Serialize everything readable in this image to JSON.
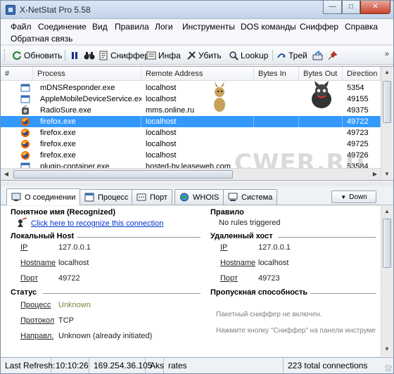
{
  "window": {
    "title": "X-NetStat Pro 5.58"
  },
  "menu": {
    "items": [
      "Файл",
      "Соединение",
      "Вид",
      "Правила",
      "Логи",
      "Инструменты",
      "DOS команды",
      "Сниффер",
      "Справка",
      "Обратная связь"
    ]
  },
  "toolbar": {
    "refresh": "Обновить",
    "pause_icon": "pause-icon",
    "find_icon": "binoculars-icon",
    "sniffer": "Сниффер",
    "info": "Инфа",
    "kill": "Убить",
    "lookup": "Lookup",
    "trace": "Трей"
  },
  "grid": {
    "columns": [
      "#",
      "Process",
      "Remote Address",
      "Bytes In",
      "Bytes Out",
      "Direction"
    ],
    "rows": [
      {
        "process": "mDNSResponder.exe",
        "remote": "localhost",
        "bytes_in": "",
        "bytes_out": "",
        "direction": "5354",
        "icon": "window-icon",
        "selected": false
      },
      {
        "process": "AppleMobileDeviceService.exe",
        "remote": "localhost",
        "bytes_in": "",
        "bytes_out": "",
        "direction": "49155",
        "icon": "window-icon",
        "selected": false
      },
      {
        "process": "RadioSure.exe",
        "remote": "mms.online.ru",
        "bytes_in": "",
        "bytes_out": "",
        "direction": "49375",
        "icon": "radio-icon",
        "selected": false
      },
      {
        "process": "firefox.exe",
        "remote": "localhost",
        "bytes_in": "",
        "bytes_out": "",
        "direction": "49722",
        "icon": "firefox-icon",
        "selected": true
      },
      {
        "process": "firefox.exe",
        "remote": "localhost",
        "bytes_in": "",
        "bytes_out": "",
        "direction": "49723",
        "icon": "firefox-icon",
        "selected": false
      },
      {
        "process": "firefox.exe",
        "remote": "localhost",
        "bytes_in": "",
        "bytes_out": "",
        "direction": "49725",
        "icon": "firefox-icon",
        "selected": false
      },
      {
        "process": "firefox.exe",
        "remote": "localhost",
        "bytes_in": "",
        "bytes_out": "",
        "direction": "49726",
        "icon": "firefox-icon",
        "selected": false
      },
      {
        "process": "plugin-container.exe",
        "remote": "hosted-by.leaseweb.com",
        "bytes_in": "",
        "bytes_out": "",
        "direction": "53584",
        "icon": "window-icon",
        "selected": false
      }
    ],
    "watermark": "CWER.RU"
  },
  "tabs": {
    "connection": "О соединении",
    "process": "Процесс",
    "port": "Порт",
    "whois": "WHOIS",
    "system": "Система",
    "down": "Down"
  },
  "details": {
    "friendly_name_header": "Понятное имя (Recognized)",
    "recognize_link": "Click here to recognize this connection",
    "rule_header": "Правило",
    "rule_value": "No rules triggered",
    "local_host_header": "Локальный Host",
    "remote_host_header": "Удаленный хост",
    "local": {
      "ip_label": "IP",
      "ip": "127.0.0.1",
      "hostname_label": "Hostname",
      "hostname": "localhost",
      "port_label": "Порт",
      "port": "49722"
    },
    "remote": {
      "ip_label": "IP",
      "ip": "127.0.0.1",
      "hostname_label": "Hostname",
      "hostname": "localhost",
      "port_label": "Порт",
      "port": "49723"
    },
    "status_header": "Статус",
    "bandwidth_header": "Пропускная способность",
    "process_label": "Процесс",
    "process_value": "Unknown",
    "protocol_label": "Протокол",
    "protocol_value": "TCP",
    "direction_label": "Направл.",
    "direction_value": "Unknown (already initiated)",
    "sniffer_off": "Пакетный сниффер не включен.",
    "sniffer_hint": "Нажмите кнопку \"Сниффер\" на панели инструме"
  },
  "status": {
    "last_refresh_label": "Last Refresh:",
    "time": "10:10:26",
    "ip": "169.254.36.105",
    "aks": "Aks",
    "rates": "rates",
    "total": "223 total connections"
  },
  "colors": {
    "selection": "#3399ff",
    "link": "#0033cc",
    "header_rule": "#8d97a3"
  }
}
